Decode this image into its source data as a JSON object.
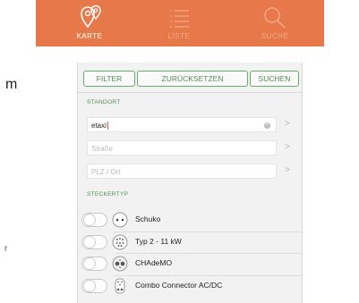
{
  "tabs": [
    {
      "label": "KARTE",
      "icon": "map-pins-icon"
    },
    {
      "label": "LISTE",
      "icon": "list-icon"
    },
    {
      "label": "SUCHE",
      "icon": "search-icon"
    }
  ],
  "side": {
    "letter": "m",
    "mark": "r"
  },
  "toolbar": {
    "filter": "FILTER",
    "reset": "ZURÜCKSETZEN",
    "search": "SUCHEN"
  },
  "standort": {
    "header": "STANDORT",
    "query_value": "etaxi",
    "street_placeholder": "Straße",
    "city_placeholder": "PLZ / Ort"
  },
  "steckertyp": {
    "header": "STECKERTYP",
    "items": [
      {
        "name": "Schuko",
        "icon": "schuko-plug-icon"
      },
      {
        "name": "Typ 2 - 11 kW",
        "icon": "type2-plug-icon"
      },
      {
        "name": "CHAdeMO",
        "icon": "chademo-plug-icon"
      },
      {
        "name": "Combo Connector AC/DC",
        "icon": "combo-plug-icon"
      }
    ]
  },
  "colors": {
    "tabbar": "#e6784a",
    "accent": "#4f8f52"
  }
}
